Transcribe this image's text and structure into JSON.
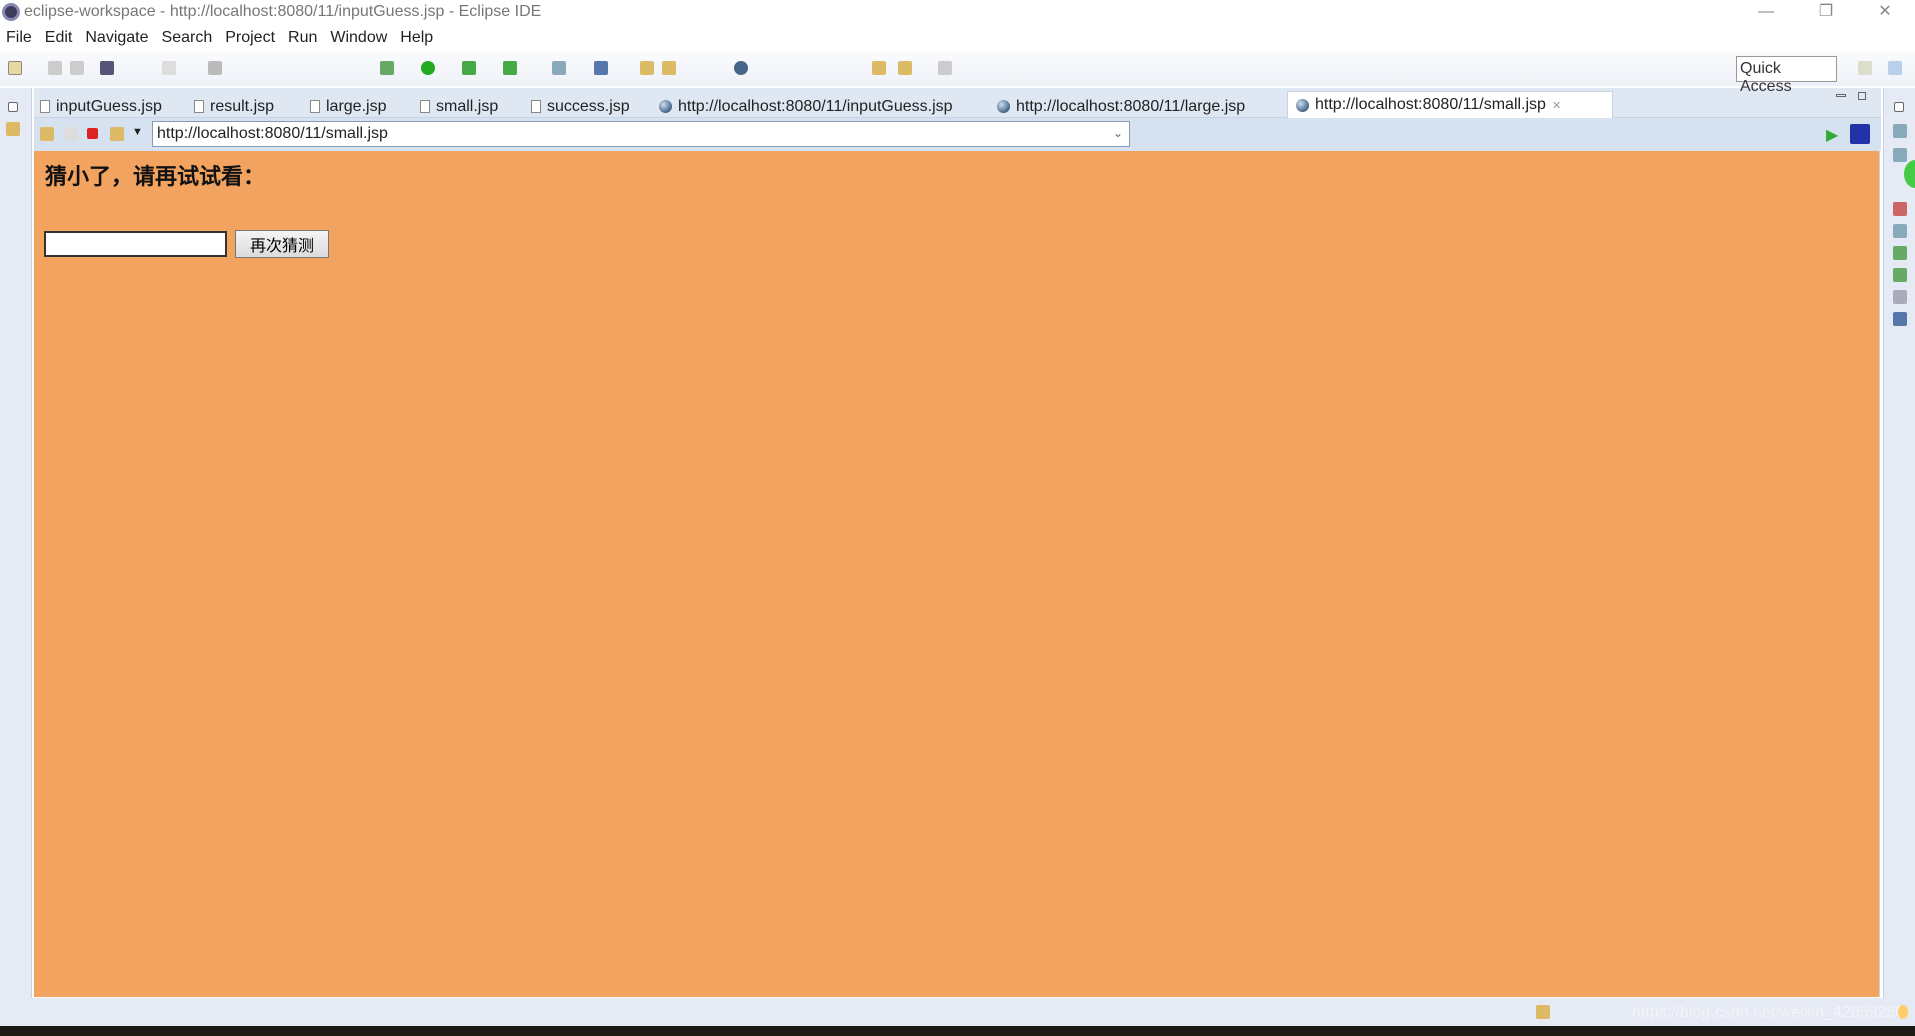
{
  "window": {
    "title": "eclipse-workspace - http://localhost:8080/11/inputGuess.jsp - Eclipse IDE",
    "minimize": "—",
    "restore": "❐",
    "close": "✕"
  },
  "menu": [
    "File",
    "Edit",
    "Navigate",
    "Search",
    "Project",
    "Run",
    "Window",
    "Help"
  ],
  "toolbar": {
    "quick_access": "Quick Access"
  },
  "tabs": [
    {
      "label": "inputGuess.jsp",
      "icon": "file-icon"
    },
    {
      "label": "result.jsp",
      "icon": "file-icon"
    },
    {
      "label": "large.jsp",
      "icon": "file-icon"
    },
    {
      "label": "small.jsp",
      "icon": "file-icon"
    },
    {
      "label": "success.jsp",
      "icon": "file-icon"
    },
    {
      "label": "http://localhost:8080/11/inputGuess.jsp",
      "icon": "globe-icon"
    },
    {
      "label": "http://localhost:8080/11/large.jsp",
      "icon": "globe-icon"
    },
    {
      "label": "http://localhost:8080/11/small.jsp",
      "icon": "globe-icon",
      "active": true,
      "close": "✕"
    }
  ],
  "browser": {
    "url": "http://localhost:8080/11/small.jsp"
  },
  "page": {
    "headline": "猜小了，请再试试看：",
    "input_value": "",
    "button": "再次猜测",
    "background": "#f2a360"
  },
  "status": {
    "watermark": "https://blog.csdn.net/weixin_42859280"
  }
}
